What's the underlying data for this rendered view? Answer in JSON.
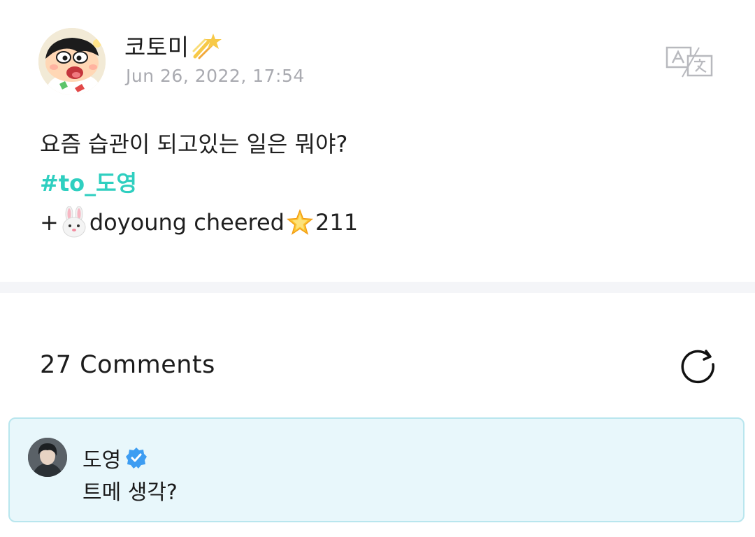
{
  "post": {
    "author": "코토미",
    "author_emoji": "shooting-star-icon",
    "timestamp": "Jun 26, 2022, 17:54",
    "lines": {
      "question": "요즘 습관이 되고있는 일은 뭐야?",
      "hashtag": "#to_도영",
      "cheer_prefix": "+",
      "cheer_text": "doyoung cheered",
      "cheer_count": "211"
    },
    "translate_icon": "translate-icon"
  },
  "comments": {
    "count_label": "27 Comments",
    "refresh_icon": "refresh-icon",
    "highlighted": {
      "author": "도영",
      "verified_icon": "verified-badge-icon",
      "text": "트메 생각?"
    }
  },
  "colors": {
    "hashtag": "#2fcfc0",
    "timestamp": "#a9aab0",
    "comment_bg": "#e8f7fb",
    "comment_border": "#b9e6ee",
    "verified": "#3d9df2",
    "divider": "#f4f5f8"
  }
}
